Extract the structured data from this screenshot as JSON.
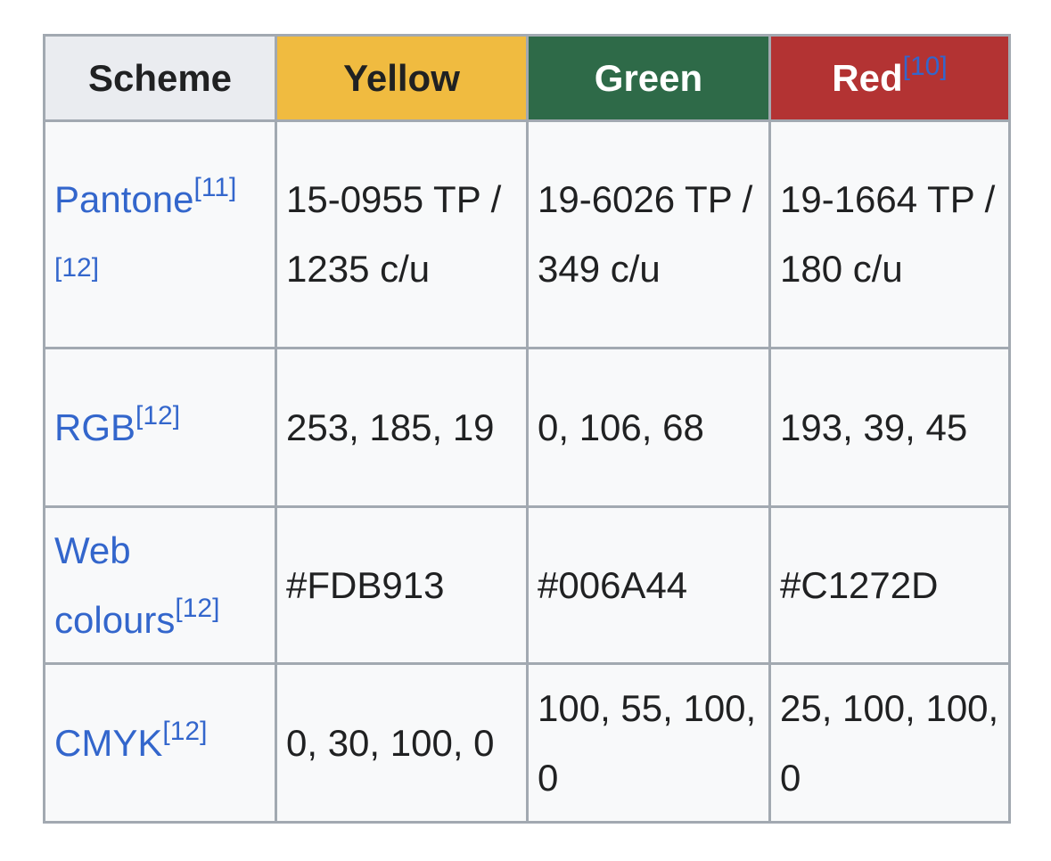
{
  "header": {
    "scheme": "Scheme",
    "yellow": "Yellow",
    "green": "Green",
    "red": "Red",
    "red_ref": "[10]"
  },
  "rows": [
    {
      "label": "Pantone",
      "refs": [
        "[11]",
        "[12]"
      ],
      "yellow": "15-0955 TP / 1235 c/u",
      "green": "19-6026 TP / 349 c/u",
      "red": "19-1664 TP / 180 c/u"
    },
    {
      "label": "RGB",
      "refs": [
        "[12]"
      ],
      "yellow": "253, 185, 19",
      "green": "0, 106, 68",
      "red": "193, 39, 45"
    },
    {
      "label": "Web colours",
      "refs": [
        "[12]"
      ],
      "yellow": "#FDB913",
      "green": "#006A44",
      "red": "#C1272D"
    },
    {
      "label": "CMYK",
      "refs": [
        "[12]"
      ],
      "yellow": "0, 30, 100, 0",
      "green": "100, 55, 100, 0",
      "red": "25, 100, 100, 0"
    }
  ],
  "colors": {
    "yellow_header": "#f0bb40",
    "green_header": "#2e6a48",
    "red_header": "#b33333",
    "link": "#3366cc"
  }
}
